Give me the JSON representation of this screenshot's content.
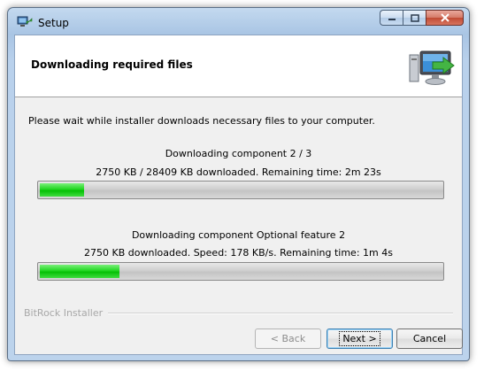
{
  "window": {
    "title": "Setup",
    "icon": "setup-app-icon"
  },
  "header": {
    "title": "Downloading required files",
    "icon": "computer-download-icon"
  },
  "intro_text": "Please wait while installer downloads necessary files to your computer.",
  "downloads": [
    {
      "title": "Downloading component 2 / 3",
      "details": "2750 KB / 28409 KB downloaded. Remaining time: 2m 23s",
      "progress": 0.11
    },
    {
      "title": "Downloading component Optional feature 2",
      "details": "2750 KB downloaded. Speed: 178 KB/s. Remaining time: 1m 4s",
      "progress": 0.198
    }
  ],
  "branding": "BitRock Installer",
  "buttons": {
    "back": "< Back",
    "next": "Next >",
    "cancel": "Cancel"
  },
  "colors": {
    "progress_fill": "#06c006",
    "branding_text": "#a8a8a8"
  }
}
